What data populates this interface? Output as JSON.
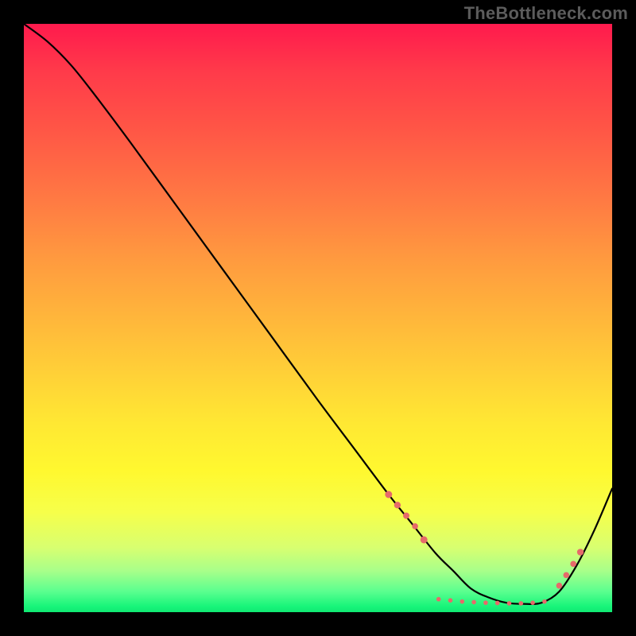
{
  "watermark": "TheBottleneck.com",
  "chart_data": {
    "type": "line",
    "title": "",
    "xlabel": "",
    "ylabel": "",
    "xlim": [
      0,
      100
    ],
    "ylim": [
      0,
      100
    ],
    "grid": false,
    "legend": false,
    "series": [
      {
        "name": "curve",
        "x": [
          0,
          4,
          8,
          12,
          18,
          26,
          34,
          42,
          50,
          56,
          62,
          66,
          70,
          73,
          76,
          79,
          82,
          85,
          88,
          91,
          94,
          97,
          100
        ],
        "y": [
          100,
          97,
          93,
          88,
          80,
          69,
          58,
          47,
          36,
          28,
          20,
          15,
          10,
          7,
          4,
          2.5,
          1.6,
          1.4,
          1.6,
          3.5,
          8,
          14,
          21
        ]
      }
    ],
    "markers": {
      "name": "highlight-band",
      "color": "#e66a6a",
      "points": [
        {
          "x": 62,
          "y": 20,
          "r": 4.5
        },
        {
          "x": 63.5,
          "y": 18.2,
          "r": 4.2
        },
        {
          "x": 65,
          "y": 16.4,
          "r": 4.0
        },
        {
          "x": 66.5,
          "y": 14.6,
          "r": 3.8
        },
        {
          "x": 68,
          "y": 12.3,
          "r": 4.5
        },
        {
          "x": 70.5,
          "y": 2.2,
          "r": 2.8
        },
        {
          "x": 72.5,
          "y": 2.0,
          "r": 2.8
        },
        {
          "x": 74.5,
          "y": 1.8,
          "r": 2.8
        },
        {
          "x": 76.5,
          "y": 1.7,
          "r": 2.8
        },
        {
          "x": 78.5,
          "y": 1.6,
          "r": 2.8
        },
        {
          "x": 80.5,
          "y": 1.55,
          "r": 2.8
        },
        {
          "x": 82.5,
          "y": 1.5,
          "r": 2.8
        },
        {
          "x": 84.5,
          "y": 1.5,
          "r": 2.8
        },
        {
          "x": 86.5,
          "y": 1.6,
          "r": 2.8
        },
        {
          "x": 88.5,
          "y": 1.8,
          "r": 2.8
        },
        {
          "x": 91,
          "y": 4.5,
          "r": 3.8
        },
        {
          "x": 92.2,
          "y": 6.3,
          "r": 3.8
        },
        {
          "x": 93.4,
          "y": 8.2,
          "r": 3.8
        },
        {
          "x": 94.6,
          "y": 10.2,
          "r": 4.2
        }
      ]
    },
    "gradient_stops": [
      {
        "pos": 0,
        "color": "#ff1a4d"
      },
      {
        "pos": 0.5,
        "color": "#ffb63b"
      },
      {
        "pos": 0.78,
        "color": "#fff82f"
      },
      {
        "pos": 0.97,
        "color": "#18f57a"
      },
      {
        "pos": 1.0,
        "color": "#10e872"
      }
    ]
  }
}
